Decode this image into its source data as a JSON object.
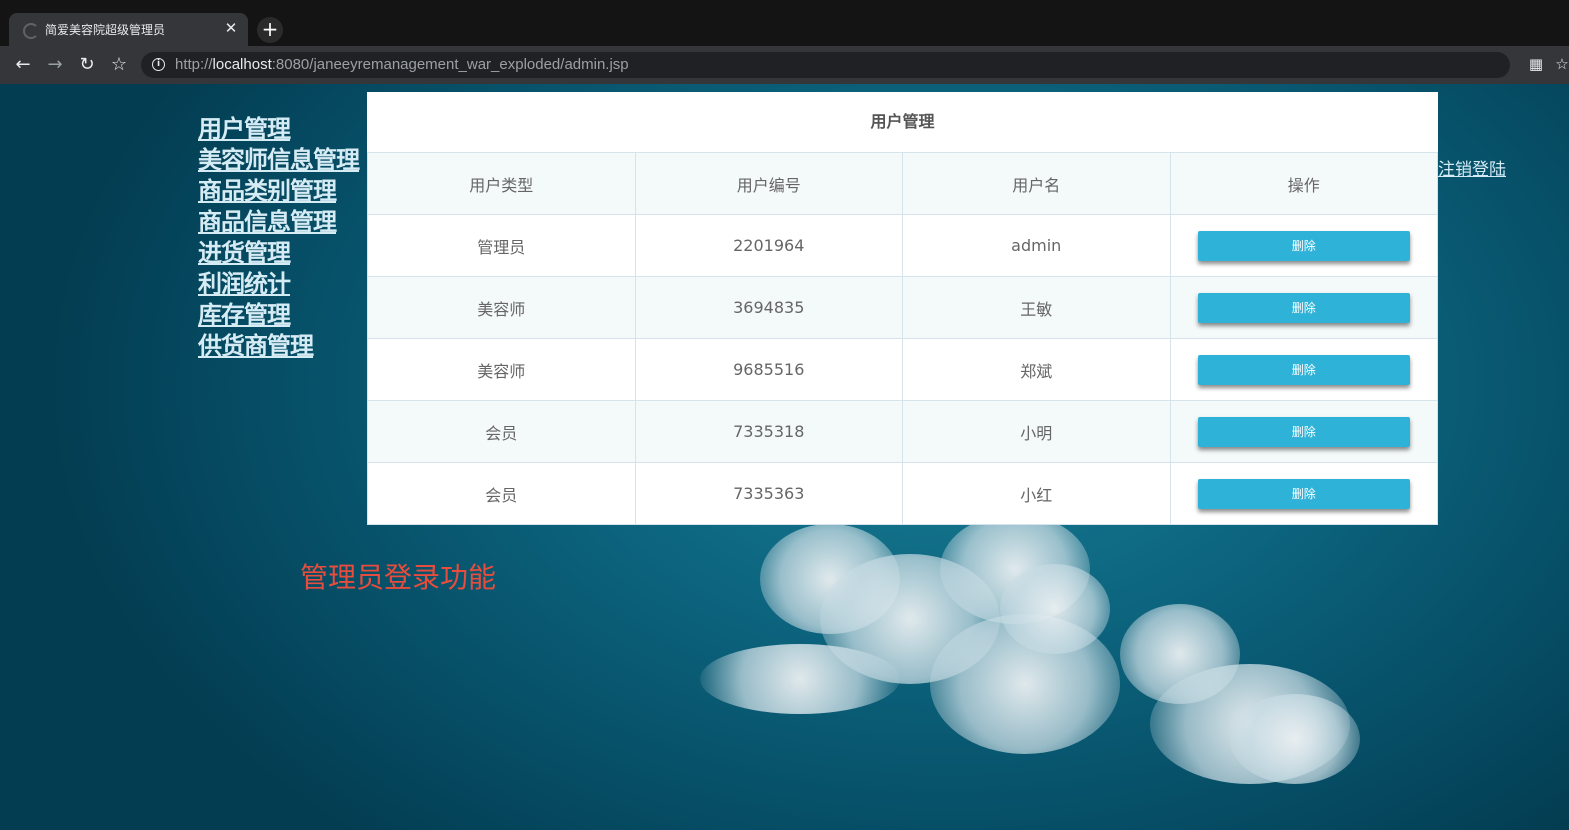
{
  "browser": {
    "tab_title": "简爱美容院超级管理员",
    "url_scheme": "http://",
    "url_host": "localhost",
    "url_rest": ":8080/janeeyremanagement_war_exploded/admin.jsp"
  },
  "sidebar": {
    "items": [
      {
        "label": "用户管理"
      },
      {
        "label": "美容师信息管理"
      },
      {
        "label": "商品类别管理"
      },
      {
        "label": "商品信息管理"
      },
      {
        "label": "进货管理"
      },
      {
        "label": "利润统计"
      },
      {
        "label": "库存管理"
      },
      {
        "label": "供货商管理"
      }
    ]
  },
  "logout_label": "注销登陆",
  "feature_label": "管理员登录功能",
  "table": {
    "title": "用户管理",
    "headers": [
      "用户类型",
      "用户编号",
      "用户名",
      "操作"
    ],
    "rows": [
      {
        "type": "管理员",
        "id": "2201964",
        "name": "admin",
        "action": "删除"
      },
      {
        "type": "美容师",
        "id": "3694835",
        "name": "王敏",
        "action": "删除"
      },
      {
        "type": "美容师",
        "id": "9685516",
        "name": "郑斌",
        "action": "删除"
      },
      {
        "type": "会员",
        "id": "7335318",
        "name": "小明",
        "action": "删除"
      },
      {
        "type": "会员",
        "id": "7335363",
        "name": "小红",
        "action": "删除"
      }
    ]
  },
  "colors": {
    "button": "#2fb2d8",
    "feature_label": "#e74c3c",
    "background": "#0d6680"
  }
}
